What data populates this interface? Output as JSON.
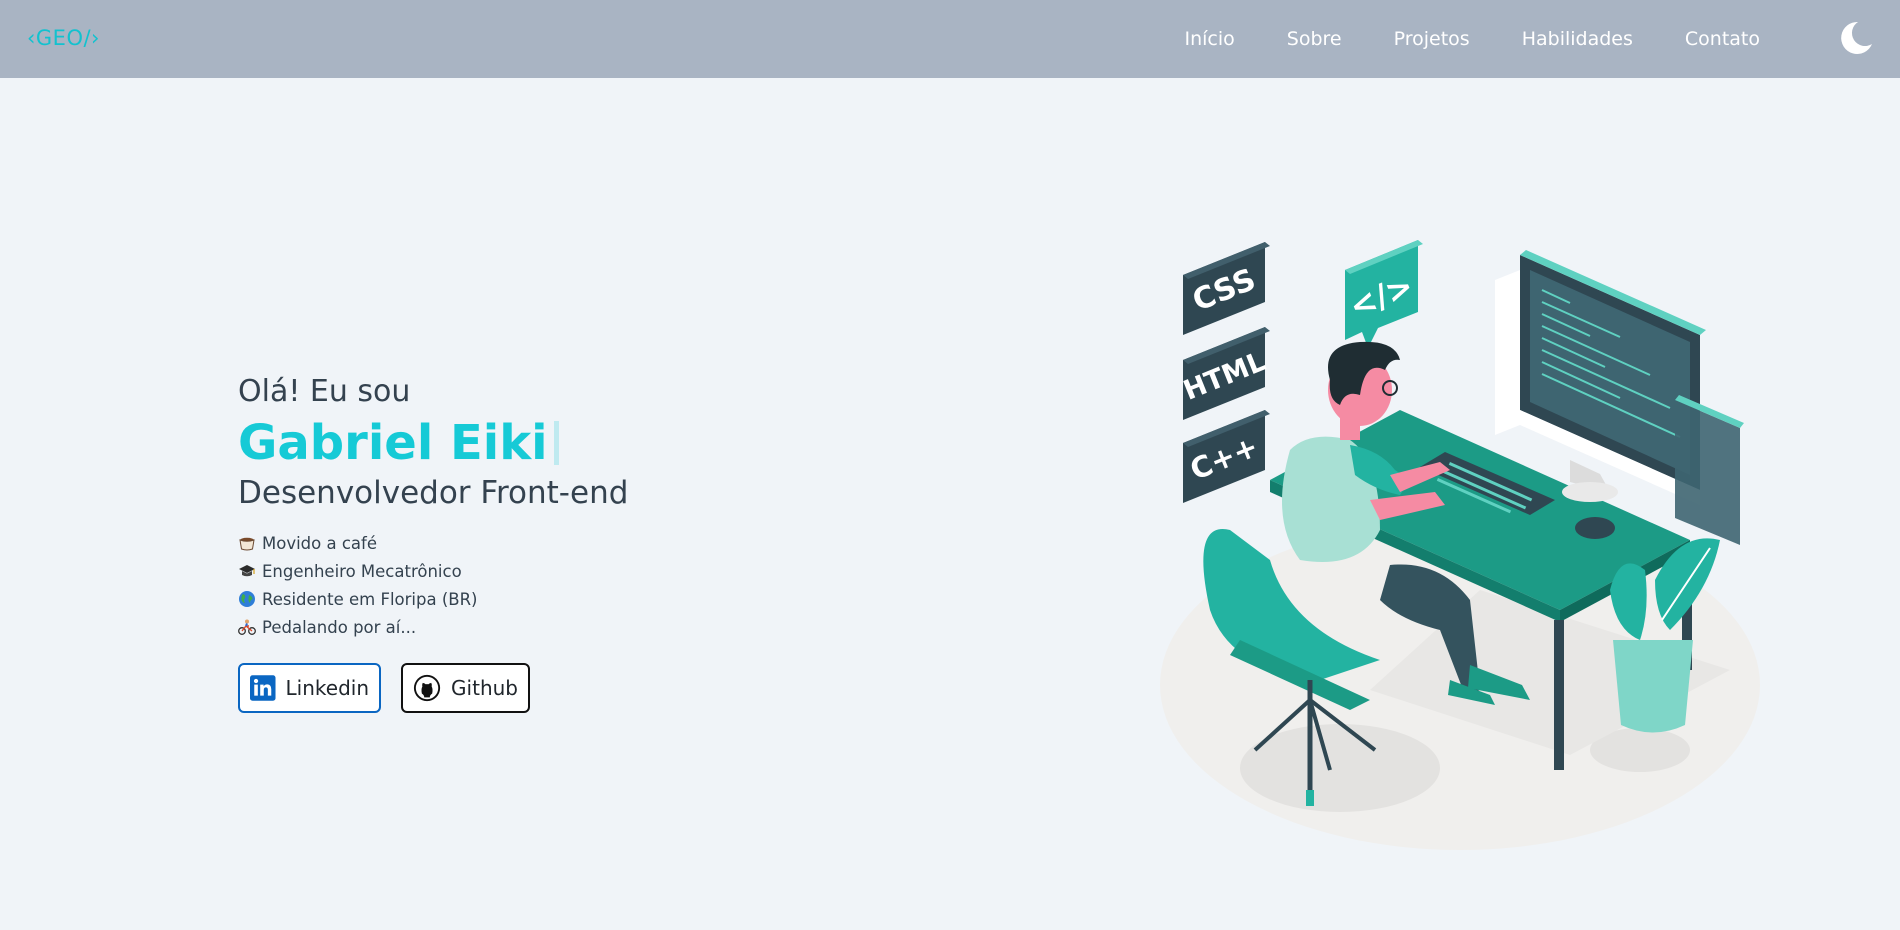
{
  "header": {
    "logo": "‹GEO/›",
    "nav": [
      {
        "label": "Início"
      },
      {
        "label": "Sobre"
      },
      {
        "label": "Projetos"
      },
      {
        "label": "Habilidades"
      },
      {
        "label": "Contato"
      }
    ],
    "theme_icon": "moon-icon"
  },
  "hero": {
    "greeting": "Olá! Eu sou",
    "name": "Gabriel Eiki",
    "role": "Desenvolvedor Front-end",
    "facts": [
      {
        "icon": "coffee-icon",
        "text": "Movido a café"
      },
      {
        "icon": "graduation-cap-icon",
        "text": "Engenheiro Mecatrônico"
      },
      {
        "icon": "globe-icon",
        "text": "Residente em Floripa (BR)"
      },
      {
        "icon": "cyclist-icon",
        "text": "Pedalando por aí..."
      }
    ],
    "buttons": {
      "linkedin": "Linkedin",
      "github": "Github"
    }
  },
  "illustration": {
    "badges": [
      "CSS",
      "HTML",
      "C++"
    ],
    "code_badge": "</>"
  },
  "colors": {
    "accent": "#16cad6",
    "header_bg": "#a9b4c3",
    "page_bg": "#f0f4f8",
    "teal": "#1f9e8a",
    "dark": "#2f4752"
  }
}
